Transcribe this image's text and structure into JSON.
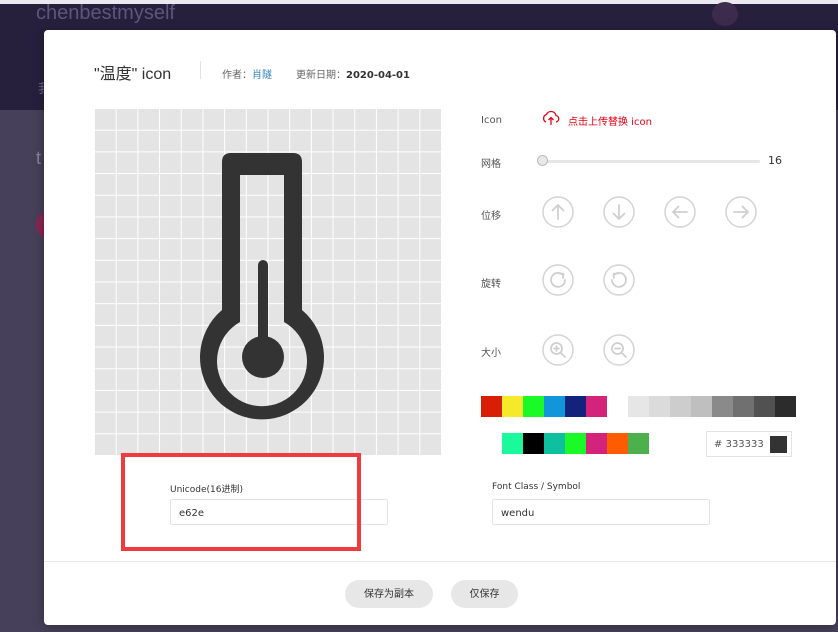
{
  "background": {
    "brand": "chenbestmyself",
    "nav_char": "我",
    "title_char": "t"
  },
  "dialog": {
    "title": "\"温度\" icon",
    "author_label": "作者：",
    "author": "肖隧",
    "updated_label": "更新日期：",
    "updated_date": "2020-04-01"
  },
  "icon_preview": {
    "icon": "thermometer-icon",
    "color": "#333333",
    "grid_cells": 16
  },
  "controls": {
    "icon_label": "Icon",
    "upload_text": "点击上传替换 icon",
    "grid_label": "网格",
    "grid_value": "16",
    "move_label": "位移",
    "rotate_label": "旋转",
    "size_label": "大小"
  },
  "palette": {
    "row1": [
      "#d81e06",
      "#f4ea2a",
      "#1afa29",
      "#1296db",
      "#13227a",
      "#d4237a",
      "#ffffff",
      "#e6e6e6",
      "#dbdbdb",
      "#cdcdcd",
      "#bfbfbf",
      "#8a8a8a",
      "#707070",
      "#515151",
      "#2c2c2c"
    ],
    "row2": [
      "#ffffff",
      "#1afa9a",
      "#000000",
      "#0ec0a0",
      "#1afa29",
      "#d4237a",
      "#ff5b00",
      "#4cb04c"
    ]
  },
  "color_input": {
    "hash": "#",
    "value": "333333",
    "swatch": "#333333"
  },
  "unicode": {
    "label": "Unicode(16进制)",
    "value": "e62e"
  },
  "font_class": {
    "label": "Font Class / Symbol",
    "value": "wendu"
  },
  "footer": {
    "save_copy": "保存为副本",
    "save_only": "仅保存"
  }
}
